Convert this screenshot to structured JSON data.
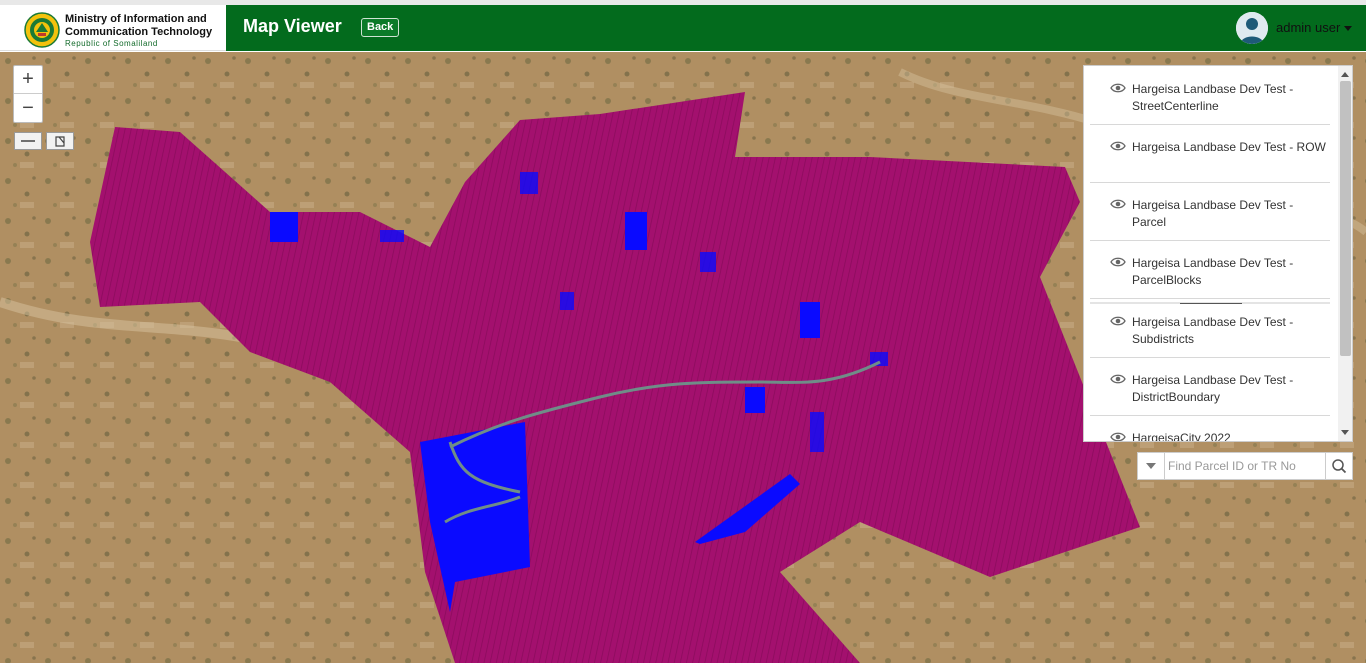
{
  "header": {
    "org_line1": "Ministry of Information  and",
    "org_line2": "Communication Technology",
    "org_line3": "Republic of Somaliland",
    "title": "Map Viewer",
    "back_label": "Back",
    "user_name": "admin user",
    "brand_color": "#036b1d"
  },
  "map": {
    "zoom_in_label": "+",
    "zoom_out_label": "−",
    "parcel_color": "#a3106e",
    "block_color": "#0a0aff"
  },
  "layers": {
    "items": [
      {
        "label": "Hargeisa Landbase Dev Test - StreetCenterline"
      },
      {
        "label": "Hargeisa Landbase Dev Test - ROW"
      },
      {
        "label": "Hargeisa Landbase Dev Test - Parcel"
      },
      {
        "label": "Hargeisa Landbase Dev Test - ParcelBlocks"
      },
      {
        "label": "Hargeisa Landbase Dev Test - Subdistricts"
      },
      {
        "label": "Hargeisa Landbase Dev Test - DistrictBoundary"
      },
      {
        "label": "HargeisaCity 2022"
      }
    ]
  },
  "search": {
    "placeholder": "Find Parcel ID or TR No"
  }
}
